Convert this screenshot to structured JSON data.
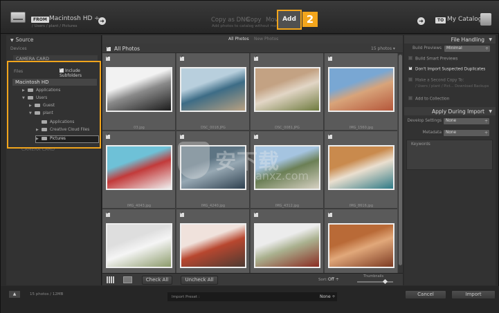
{
  "topbar": {
    "from_badge": "FROM",
    "source_name": "Macintosh HD ÷",
    "source_path": "/ Users / plant / Pictures",
    "modes": [
      "Copy as DNG",
      "Copy",
      "Move"
    ],
    "mode_subtitle": "Add photos to catalog without moving them",
    "active_mode": "Add",
    "callout_2": "2",
    "to_badge": "TO",
    "destination": "My Catalog",
    "arrow_glyph": "➜"
  },
  "source_panel": {
    "header": "Source",
    "devices_label": "Devices",
    "camera_card": "CAMERA CARD",
    "camera_card_2": "CAMERA CARD",
    "files_label": "Files",
    "include_subfolders": "Include Subfolders",
    "callout_1": "1",
    "tree": {
      "root": "Macintosh HD",
      "items": [
        {
          "label": "Applications",
          "toggle": "▶"
        },
        {
          "label": "Users",
          "toggle": "▼"
        },
        {
          "label": "Guest",
          "toggle": "▶"
        },
        {
          "label": "plant",
          "toggle": "▼"
        },
        {
          "label": "Applications",
          "toggle": ""
        },
        {
          "label": "Creative Cloud Files",
          "toggle": "▶"
        },
        {
          "label": "Pictures",
          "toggle": "▶"
        }
      ]
    }
  },
  "grid": {
    "tabs": [
      "All Photos",
      "New Photos"
    ],
    "header_title": "All Photos",
    "photo_count": "15 photos ▾",
    "photos": [
      {
        "name": "03.jpg",
        "colors": [
          "#f2f2f2",
          "#1c1c1c",
          "#8a8a8a"
        ]
      },
      {
        "name": "DSC_0018.JPG",
        "colors": [
          "#b8cfdd",
          "#b8a081",
          "#3d6c86"
        ]
      },
      {
        "name": "DSC_0081.JPG",
        "colors": [
          "#c3a283",
          "#6e7a3e",
          "#e2d6c6"
        ]
      },
      {
        "name": "IMG_1560.jpg",
        "colors": [
          "#79a7d3",
          "#b5563a",
          "#d8a47a"
        ]
      },
      {
        "name": "IMG_4043.jpg",
        "colors": [
          "#6ec1d7",
          "#efefef",
          "#c23a3a"
        ]
      },
      {
        "name": "IMG_4240.jpg",
        "colors": [
          "#5d7483",
          "#2f4150",
          "#98a9b4"
        ]
      },
      {
        "name": "IMG_4312.jpg",
        "colors": [
          "#a5c4e0",
          "#d7d1c3",
          "#6b7f55"
        ]
      },
      {
        "name": "IMG_8616.jpg",
        "colors": [
          "#c98a4d",
          "#2e7a86",
          "#eadfcf"
        ]
      },
      {
        "name": "",
        "colors": [
          "#dedede",
          "#8c9b6b",
          "#f5f5f5"
        ]
      },
      {
        "name": "",
        "colors": [
          "#f0e2dc",
          "#4c3a32",
          "#b8472f"
        ]
      },
      {
        "name": "",
        "colors": [
          "#ececec",
          "#8a2c22",
          "#aab18f"
        ]
      },
      {
        "name": "",
        "colors": [
          "#b96a37",
          "#7c3a22",
          "#e1a87a"
        ]
      }
    ]
  },
  "toolbar": {
    "check_all": "Check All",
    "uncheck_all": "Uncheck All",
    "sort_label": "Sort:",
    "sort_value": "Off ÷",
    "thumbnail_label": "Thumbnails"
  },
  "file_handling": {
    "title": "File Handling",
    "build_previews_label": "Build Previews",
    "build_previews_value": "Minimal",
    "build_smart_previews": "Build Smart Previews",
    "dont_import_duplicates": "Don't Import Suspected Duplicates",
    "second_copy": "Make a Second Copy To:",
    "second_copy_path": "/ Users / plant / Pict...  Download Backups",
    "add_to_collection": "Add to Collection"
  },
  "apply_during_import": {
    "title": "Apply During Import",
    "develop_label": "Develop Settings",
    "develop_value": "None",
    "metadata_label": "Metadata",
    "metadata_value": "None",
    "keywords_label": "Keywords"
  },
  "bottombar": {
    "expand": "▲",
    "status": "15 photos / 12MB",
    "import_preset_label": "Import Preset :",
    "import_preset_value": "None ÷",
    "cancel": "Cancel",
    "import": "Import"
  },
  "watermark": {
    "text": "安下载",
    "sub": "anxz.com"
  },
  "colors": {
    "highlight": "#f2a51c",
    "panel": "#323232",
    "grid_cell": "#5a5a5a"
  }
}
